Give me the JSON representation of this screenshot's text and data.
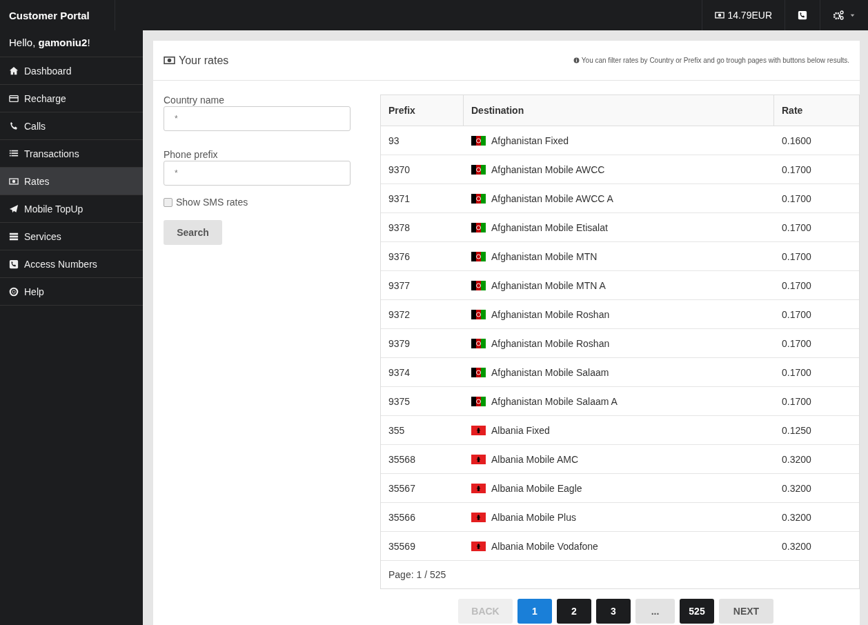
{
  "topbar": {
    "brand": "Customer Portal",
    "balance": "14.79EUR"
  },
  "greeting": "Hello, **gamoniu2**!",
  "sidebar": {
    "items": [
      {
        "label": "Dashboard",
        "selected": false
      },
      {
        "label": "Recharge",
        "selected": false
      },
      {
        "label": "Calls",
        "selected": false
      },
      {
        "label": "Transactions",
        "selected": false
      },
      {
        "label": "Rates",
        "selected": true
      },
      {
        "label": "Mobile TopUp",
        "selected": false
      },
      {
        "label": "Services",
        "selected": false
      },
      {
        "label": "Access Numbers",
        "selected": false
      },
      {
        "label": "Help",
        "selected": false
      }
    ]
  },
  "panel": {
    "title": "Your rates",
    "hint": "You can filter rates by Country or Prefix and go trough pages with buttons below results."
  },
  "form": {
    "country_label": "Country name",
    "country_value": "*",
    "prefix_label": "Phone prefix",
    "prefix_value": "*",
    "sms_label": "Show SMS rates",
    "sms_checked": false,
    "search": "Search"
  },
  "table": {
    "columns": [
      "Prefix",
      "Destination",
      "Rate"
    ],
    "rows": [
      {
        "prefix": "93",
        "kind": "afghanistan",
        "destination": "Afghanistan Fixed",
        "rate": "0.1600"
      },
      {
        "prefix": "9370",
        "kind": "afghanistan",
        "destination": "Afghanistan Mobile AWCC",
        "rate": "0.1700"
      },
      {
        "prefix": "9371",
        "kind": "afghanistan",
        "destination": "Afghanistan Mobile AWCC A",
        "rate": "0.1700"
      },
      {
        "prefix": "9378",
        "kind": "afghanistan",
        "destination": "Afghanistan Mobile Etisalat",
        "rate": "0.1700"
      },
      {
        "prefix": "9376",
        "kind": "afghanistan",
        "destination": "Afghanistan Mobile MTN",
        "rate": "0.1700"
      },
      {
        "prefix": "9377",
        "kind": "afghanistan",
        "destination": "Afghanistan Mobile MTN A",
        "rate": "0.1700"
      },
      {
        "prefix": "9372",
        "kind": "afghanistan",
        "destination": "Afghanistan Mobile Roshan",
        "rate": "0.1700"
      },
      {
        "prefix": "9379",
        "kind": "afghanistan",
        "destination": "Afghanistan Mobile Roshan",
        "rate": "0.1700"
      },
      {
        "prefix": "9374",
        "kind": "afghanistan",
        "destination": "Afghanistan Mobile Salaam",
        "rate": "0.1700"
      },
      {
        "prefix": "9375",
        "kind": "afghanistan",
        "destination": "Afghanistan Mobile Salaam A",
        "rate": "0.1700"
      },
      {
        "prefix": "355",
        "kind": "albania",
        "destination": "Albania Fixed",
        "rate": "0.1250"
      },
      {
        "prefix": "35568",
        "kind": "albania",
        "destination": "Albania Mobile AMC",
        "rate": "0.3200"
      },
      {
        "prefix": "35567",
        "kind": "albania",
        "destination": "Albania Mobile Eagle",
        "rate": "0.3200"
      },
      {
        "prefix": "35566",
        "kind": "albania",
        "destination": "Albania Mobile Plus",
        "rate": "0.3200"
      },
      {
        "prefix": "35569",
        "kind": "albania",
        "destination": "Albania Mobile Vodafone",
        "rate": "0.3200"
      }
    ],
    "page_info": "Page: 1 / 525"
  },
  "pagination": [
    {
      "label": "BACK",
      "kind": "nav",
      "disabled": true,
      "selected": false
    },
    {
      "label": "1",
      "kind": "page",
      "disabled": false,
      "selected": true
    },
    {
      "label": "2",
      "kind": "page",
      "disabled": false,
      "selected": false
    },
    {
      "label": "3",
      "kind": "page",
      "disabled": false,
      "selected": false
    },
    {
      "label": "...",
      "kind": "gap",
      "disabled": false,
      "selected": false
    },
    {
      "label": "525",
      "kind": "page",
      "disabled": false,
      "selected": false
    },
    {
      "label": "NEXT",
      "kind": "nav",
      "disabled": false,
      "selected": false
    }
  ]
}
